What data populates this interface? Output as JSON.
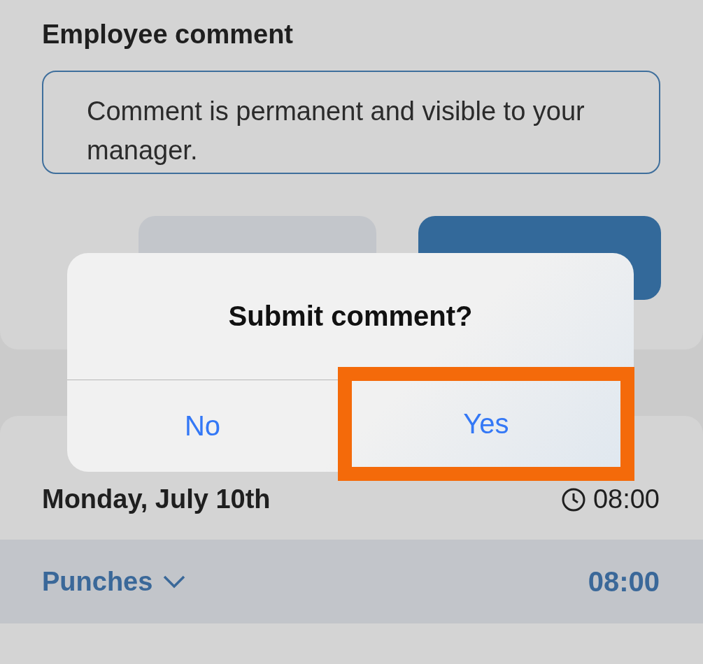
{
  "comment_card": {
    "title": "Employee comment",
    "field": {
      "placeholder": "Comment is permanent and visible to your manager."
    },
    "buttons": [
      {
        "kind": "secondary"
      },
      {
        "kind": "primary"
      }
    ]
  },
  "day_card": {
    "date": "Monday, July 10th",
    "total": "08:00",
    "punches": {
      "label": "Punches",
      "expanded": false,
      "total": "08:00"
    }
  },
  "dialog": {
    "title": "Submit comment?",
    "actions": [
      {
        "label": "No",
        "highlighted": false
      },
      {
        "label": "Yes",
        "highlighted": true
      }
    ]
  }
}
